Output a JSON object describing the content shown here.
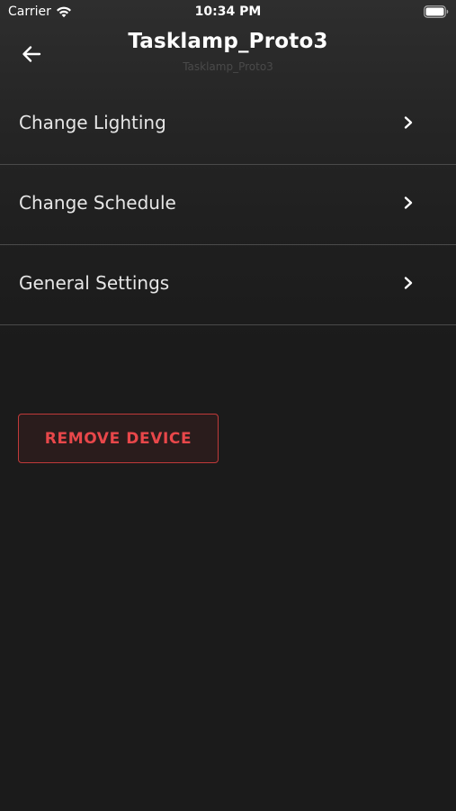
{
  "status_bar": {
    "carrier": "Carrier",
    "time": "10:34 PM",
    "icons": [
      "wifi-icon",
      "battery-icon"
    ]
  },
  "header": {
    "title": "Tasklamp_Proto3",
    "subtitle": "Tasklamp_Proto3",
    "back_icon": "arrow-left-icon"
  },
  "menu": {
    "items": [
      {
        "label": "Change Lighting",
        "icon": "chevron-right-icon"
      },
      {
        "label": "Change Schedule",
        "icon": "chevron-right-icon"
      },
      {
        "label": "General Settings",
        "icon": "chevron-right-icon"
      }
    ]
  },
  "actions": {
    "remove_label": "REMOVE DEVICE"
  },
  "colors": {
    "background": "#1b1b1b",
    "divider": "#4a4a4a",
    "danger": "#e8474a",
    "danger_border": "#c03a3a"
  }
}
